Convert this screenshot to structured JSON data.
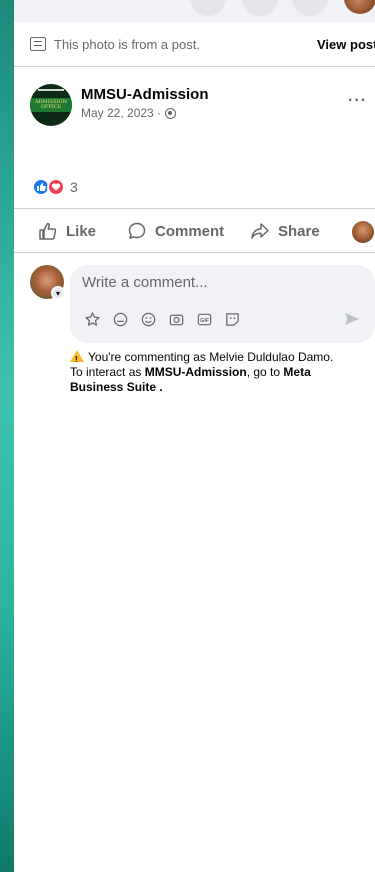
{
  "banner": {
    "text": "This photo is from a post.",
    "view_post": "View post"
  },
  "post": {
    "author": "MMSU-Admission",
    "date": "May 22, 2023 ·",
    "avatar_text": "ADMISSION OFFICE",
    "more": "···"
  },
  "reactions": {
    "count": "3"
  },
  "actions": {
    "like": "Like",
    "comment": "Comment",
    "share": "Share"
  },
  "comment": {
    "placeholder": "Write a comment...",
    "tools": [
      "sticker-icon",
      "avatar-sticker-icon",
      "emoji-icon",
      "camera-icon",
      "gif-icon",
      "sticker-face-icon"
    ]
  },
  "notice": {
    "line1": "You're commenting as Melvie Duldulao Damo.",
    "line2_pre": "To interact as ",
    "line2_page": "MMSU-Admission",
    "line2_mid": ", go to ",
    "line2_link1": "Meta",
    "line3_link2": "Business Suite",
    "line3_post": " ."
  },
  "colors": {
    "accent": "#1877f2",
    "love": "#f33e58",
    "muted": "#65676b",
    "warning": "#f7b928",
    "background_teal": "#2aa390"
  }
}
